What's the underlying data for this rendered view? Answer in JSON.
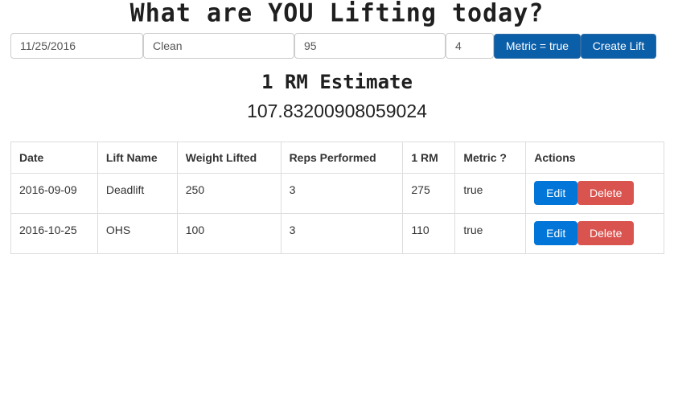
{
  "header": {
    "title": "What are YOU Lifting today?"
  },
  "form": {
    "date_value": "11/25/2016",
    "lift_value": "Clean",
    "weight_value": "95",
    "reps_value": "4",
    "metric_button": "Metric = true",
    "create_button": "Create Lift"
  },
  "estimate": {
    "title": "1 RM Estimate",
    "value": "107.83200908059024"
  },
  "table": {
    "headers": [
      "Date",
      "Lift Name",
      "Weight Lifted",
      "Reps Performed",
      "1 RM",
      "Metric ?",
      "Actions"
    ],
    "rows": [
      {
        "date": "2016-09-09",
        "lift": "Deadlift",
        "weight": "250",
        "reps": "3",
        "rm": "275",
        "metric": "true",
        "edit": "Edit",
        "delete": "Delete"
      },
      {
        "date": "2016-10-25",
        "lift": "OHS",
        "weight": "100",
        "reps": "3",
        "rm": "110",
        "metric": "true",
        "edit": "Edit",
        "delete": "Delete"
      }
    ]
  },
  "colors": {
    "primary": "#0b5ea8",
    "edit": "#0275d8",
    "delete": "#d9534f"
  }
}
